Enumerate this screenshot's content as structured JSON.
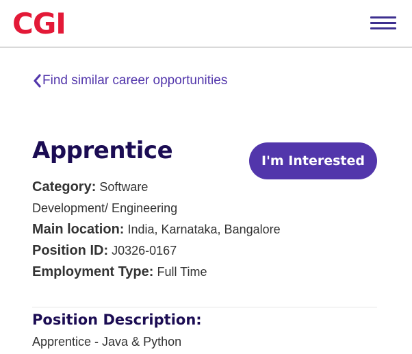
{
  "header": {
    "logo_text": "CGI",
    "logo_color": "#e31937",
    "menu_icon": "hamburger-menu-icon"
  },
  "nav": {
    "back_icon": "chevron-left-icon",
    "back_label": "Find similar career opportunities"
  },
  "job": {
    "title": "Apprentice",
    "cta_label": "I'm Interested",
    "category_label": "Category:",
    "category_value_line1": "Software",
    "category_value_line2": "Development/ Engineering",
    "location_label": "Main location:",
    "location_value": "India, Karnataka, Bangalore",
    "position_id_label": "Position ID:",
    "position_id_value": "J0326-0167",
    "employment_type_label": "Employment Type:",
    "employment_type_value": "Full Time"
  },
  "description": {
    "heading": "Position Description:",
    "text": "Apprentice - Java & Python"
  },
  "colors": {
    "accent": "#5236ab",
    "title": "#1b0c53",
    "text": "#333333"
  }
}
